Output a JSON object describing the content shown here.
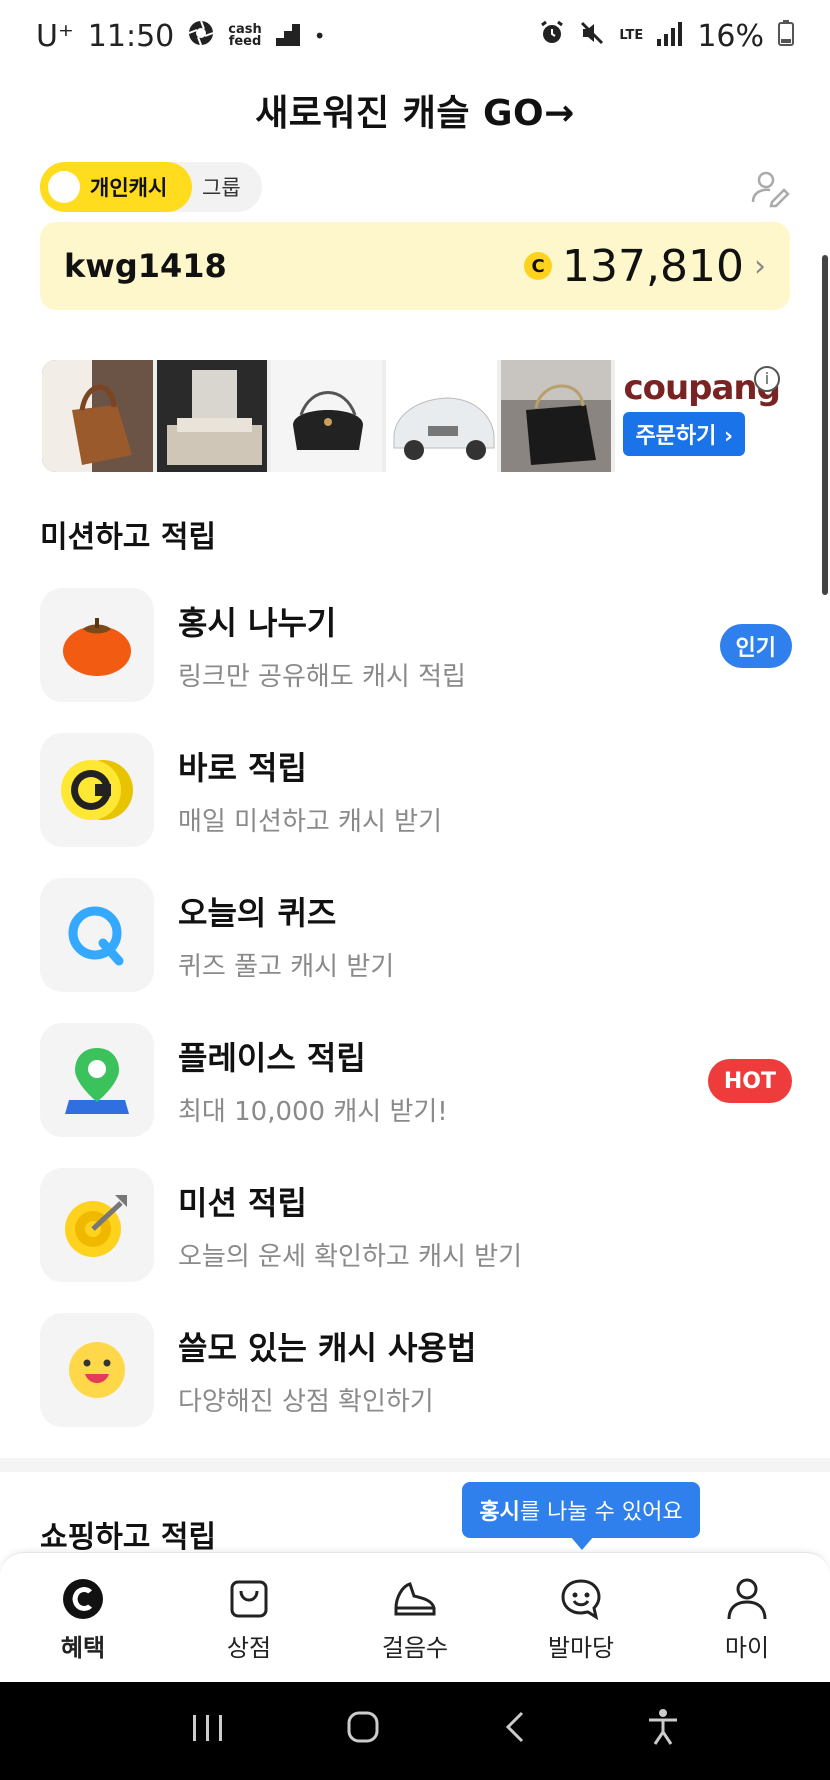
{
  "status_bar": {
    "carrier": "U⁺",
    "time": "11:50",
    "cashfeed_label": "cash\nfeed",
    "network": "LTE",
    "battery": "16%"
  },
  "header": {
    "capsule_banner": "새로워진 캐슬  GO→",
    "toggle_personal": "개인캐시",
    "toggle_group": "그룹"
  },
  "cash_card": {
    "username": "kwg1418",
    "coin_symbol": "C",
    "amount": "137,810",
    "chevron": "›"
  },
  "ad": {
    "brand": "coupang",
    "order_button": "주문하기 ›",
    "info": "i"
  },
  "mission_section": {
    "title": "미션하고 적립",
    "items": [
      {
        "title": "홍시 나누기",
        "subtitle": "링크만 공유해도 캐시 적립",
        "badge": "인기",
        "icon": "persimmon-icon"
      },
      {
        "title": "바로 적립",
        "subtitle": "매일 미션하고 캐시 받기",
        "badge": "",
        "icon": "coin-icon"
      },
      {
        "title": "오늘의 퀴즈",
        "subtitle": "퀴즈 풀고 캐시 받기",
        "badge": "",
        "icon": "quiz-icon"
      },
      {
        "title": "플레이스 적립",
        "subtitle": "최대 10,000 캐시 받기!",
        "badge": "HOT",
        "icon": "map-pin-icon"
      },
      {
        "title": "미션 적립",
        "subtitle": "오늘의 운세 확인하고 캐시 받기",
        "badge": "",
        "icon": "target-icon"
      },
      {
        "title": "쓸모 있는 캐시 사용법",
        "subtitle": "다양해진 상점 확인하기",
        "badge": "",
        "icon": "smiley-icon"
      }
    ]
  },
  "shopping_section": {
    "title": "쇼핑하고 적립"
  },
  "tooltip": {
    "bold": "홍시",
    "rest": "를 나눌 수 있어요"
  },
  "bottom_nav": {
    "items": [
      {
        "label": "혜택",
        "active": true
      },
      {
        "label": "상점",
        "active": false
      },
      {
        "label": "걸음수",
        "active": false
      },
      {
        "label": "발마당",
        "active": false
      },
      {
        "label": "마이",
        "active": false
      }
    ]
  },
  "colors": {
    "yellow": "#ffdc1e",
    "card_bg": "#fff7cc",
    "blue": "#2f80ed",
    "red": "#ee3b3b"
  }
}
